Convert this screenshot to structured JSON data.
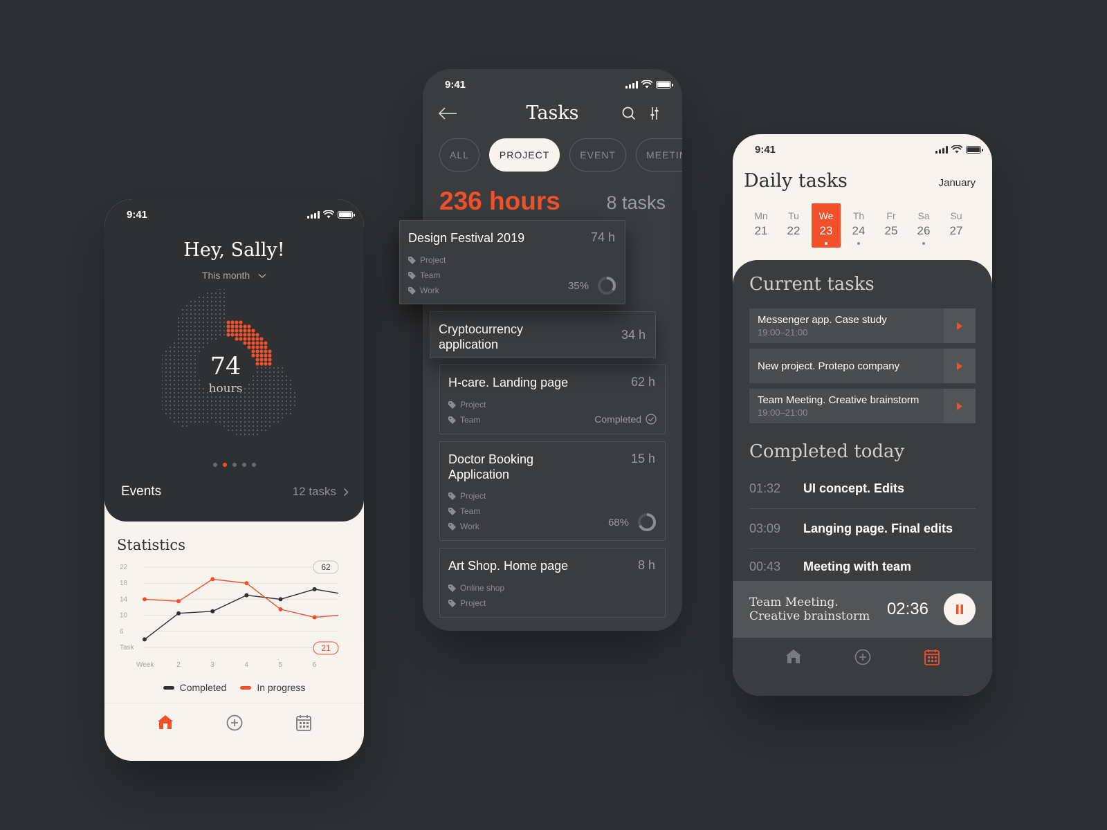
{
  "status_time": "9:41",
  "colors": {
    "accent": "#f0502a",
    "dark": "#2e3032",
    "cream": "#f7f3ee"
  },
  "home": {
    "greeting": "Hey, Sally!",
    "period": "This month",
    "total_hours": "74",
    "total_label": "hours",
    "progress_fraction": 0.25,
    "events_label": "Events",
    "events_count": "12 tasks",
    "statistics_title": "Statistics",
    "chart_data": {
      "type": "line",
      "y_ticks": [
        "22",
        "18",
        "14",
        "10",
        "6",
        "Task"
      ],
      "x_ticks": [
        "Week",
        "2",
        "3",
        "4",
        "5",
        "6"
      ],
      "ylim": [
        2,
        22
      ],
      "series": [
        {
          "name": "Completed",
          "color": "#2e3032",
          "x": [
            1,
            2,
            3,
            4,
            5,
            6,
            6.7
          ],
          "values": [
            4,
            10.5,
            11,
            15,
            14,
            16.5,
            15.5
          ]
        },
        {
          "name": "In progress",
          "color": "#f0502a",
          "x": [
            1,
            2,
            3,
            4,
            5,
            6,
            6.7
          ],
          "values": [
            14,
            13.5,
            19,
            18,
            11.5,
            9.5,
            10
          ]
        }
      ],
      "badges": [
        "62",
        "21"
      ]
    },
    "legend": {
      "completed": "Completed",
      "in_progress": "In progress"
    }
  },
  "tasks": {
    "title": "Tasks",
    "chips": [
      "ALL",
      "PROJECT",
      "EVENT",
      "MEETINGS"
    ],
    "total_hours": "236 hours",
    "total_tasks": "8 tasks",
    "cards": [
      {
        "title": "Design Festival 2019",
        "hours": "74 h",
        "tags": [
          "Project",
          "Team",
          "Work"
        ],
        "progress": "35%",
        "progress_fraction": 0.35
      },
      {
        "title": "Cryptocurrency application",
        "hours": "34 h"
      },
      {
        "title": "H-care. Landing page",
        "hours": "62 h",
        "tags": [
          "Project",
          "Team"
        ],
        "status": "Completed"
      },
      {
        "title": "Doctor Booking Application",
        "hours": "15 h",
        "tags": [
          "Project",
          "Team",
          "Work"
        ],
        "progress": "68%",
        "progress_fraction": 0.68
      },
      {
        "title": "Art Shop. Home page",
        "hours": "8 h",
        "tags": [
          "Online shop",
          "Project"
        ]
      }
    ]
  },
  "daily": {
    "title": "Daily tasks",
    "month": "January",
    "days": [
      {
        "name": "Mn",
        "date": "21",
        "mark": false
      },
      {
        "name": "Tu",
        "date": "22",
        "mark": false
      },
      {
        "name": "We",
        "date": "23",
        "mark": true
      },
      {
        "name": "Th",
        "date": "24",
        "mark": true
      },
      {
        "name": "Fr",
        "date": "25",
        "mark": false
      },
      {
        "name": "Sa",
        "date": "26",
        "mark": true
      },
      {
        "name": "Su",
        "date": "27",
        "mark": false
      }
    ],
    "current_title": "Current tasks",
    "current": [
      {
        "name": "Messenger app. Case study",
        "time": "19:00–21:00"
      },
      {
        "name": "New project. Protepo company",
        "time": ""
      },
      {
        "name": "Team Meeting. Creative brainstorm",
        "time": "19:00–21:00"
      }
    ],
    "completed_title": "Completed today",
    "completed": [
      {
        "time": "01:32",
        "name": "UI concept. Edits"
      },
      {
        "time": "03:09",
        "name": "Langing page. Final edits"
      },
      {
        "time": "00:43",
        "name": "Meeting with team"
      }
    ],
    "player": {
      "line1": "Team Meeting.",
      "line2": "Creative brainstorm",
      "time": "02:36"
    }
  }
}
